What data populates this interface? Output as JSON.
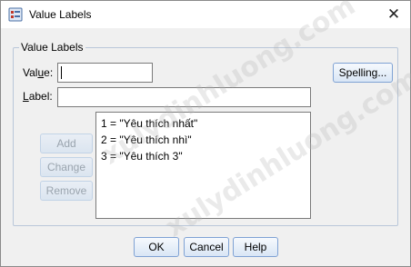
{
  "window": {
    "title": "Value Labels",
    "close_glyph": "✕"
  },
  "group": {
    "legend": "Value Labels"
  },
  "value_field": {
    "label_pre": "Val",
    "label_ul": "u",
    "label_post": "e:",
    "value": ""
  },
  "label_field": {
    "label_ul": "L",
    "label_post": "abel:",
    "value": ""
  },
  "buttons": {
    "spelling": "Spelling...",
    "add": "Add",
    "change": "Change",
    "remove": "Remove",
    "ok": "OK",
    "cancel": "Cancel",
    "help": "Help"
  },
  "list": {
    "items": [
      "1 = \"Yêu thích nhất\"",
      "2 = \"Yêu thích nhì\"",
      "3 = \"Yêu thích 3\""
    ]
  },
  "watermark": {
    "text": "xulydinhluong.com"
  }
}
